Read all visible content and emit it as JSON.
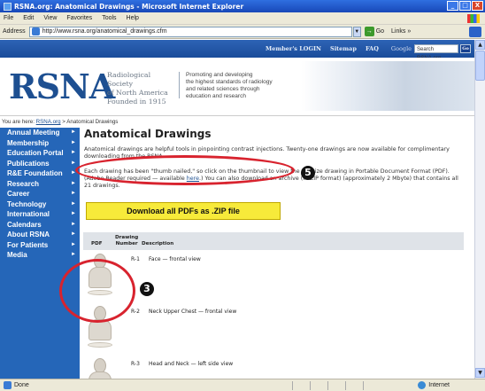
{
  "window": {
    "title": "RSNA.org: Anatomical Drawings - Microsoft Internet Explorer",
    "min": "_",
    "max": "□",
    "close": "X"
  },
  "menu": [
    "File",
    "Edit",
    "View",
    "Favorites",
    "Tools",
    "Help"
  ],
  "address": {
    "label": "Address",
    "url": "http://www.rsna.org/anatomical_drawings.cfm",
    "go": "Go",
    "links": "Links",
    "more": "»"
  },
  "topnav": {
    "items": [
      "Member's LOGIN",
      "Sitemap",
      "FAQ"
    ],
    "google": "Google",
    "search_value": "Search RSNA.org",
    "go": "Go"
  },
  "banner": {
    "logo": "RSNA",
    "society": [
      "Radiological Society",
      "of North America",
      "Founded in 1915"
    ],
    "tagline": [
      "Promoting and developing",
      "the highest standards of radiology",
      "and related sciences through",
      "education and research"
    ]
  },
  "breadcrumb": {
    "prefix": "You are here:",
    "home": "RSNA.org",
    "sep": ">",
    "current": "Anatomical Drawings"
  },
  "sidebar": {
    "items": [
      "Annual Meeting",
      "Membership",
      "Education Portal",
      "Publications",
      "R&E Foundation",
      "Research",
      "Career",
      "Technology",
      "International",
      "Calendars",
      "About RSNA",
      "For Patients",
      "Media"
    ],
    "arrow": "►"
  },
  "main": {
    "title": "Anatomical Drawings",
    "intro": "Anatomical drawings are helpful tools in pinpointing contrast injections. Twenty-one drawings are now available for complimentary downloading from the RSNA.",
    "para2_a": "Each drawing has been \"thumb nailed,\" so click on the thumbnail to view the full-size drawing in Portable Document Format (PDF). (Adobe Reader required — available ",
    "para2_link": "here",
    "para2_b": ".) You can also download an archive (in ZIP format) (approximately 2 Mbyte) that contains all 21 drawings.",
    "zip_button": "Download all PDFs as .ZIP file"
  },
  "table": {
    "col_pdf": "PDF",
    "col_num": [
      "Drawing",
      "Number"
    ],
    "col_desc": "Description",
    "rows": [
      {
        "num": "R-1",
        "desc": "Face — frontal view"
      },
      {
        "num": "R-2",
        "desc": "Neck Upper Chest — frontal view"
      },
      {
        "num": "R-3",
        "desc": "Head and Neck — left side view"
      }
    ]
  },
  "callouts": {
    "five": "5",
    "three": "3"
  },
  "status": {
    "text": "Done",
    "zone": "Internet"
  }
}
